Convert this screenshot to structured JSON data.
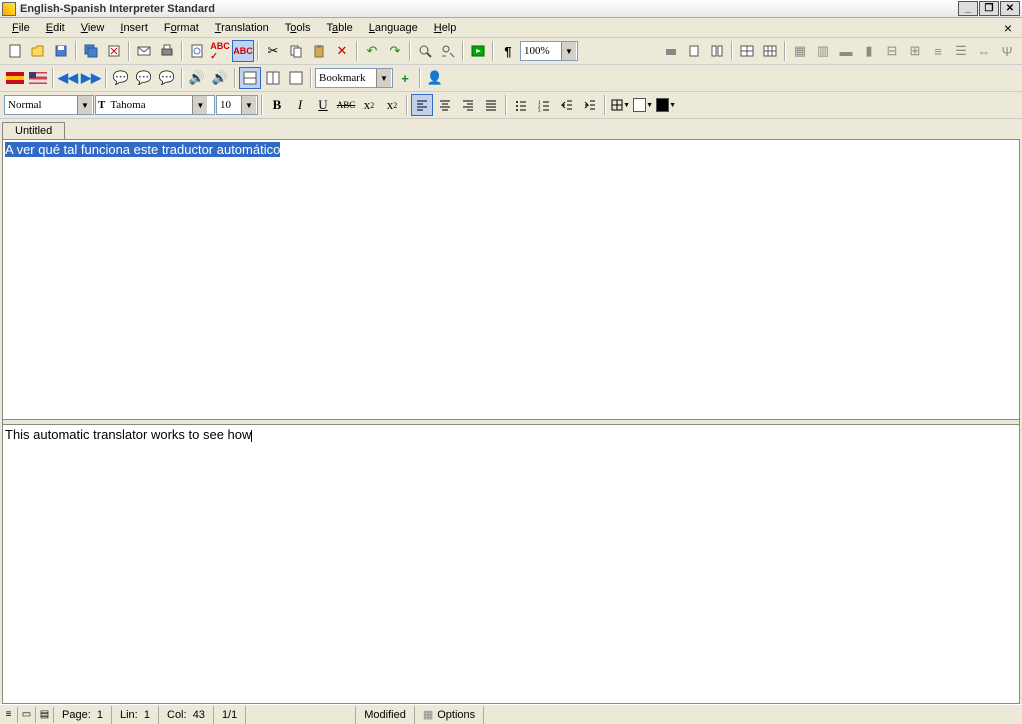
{
  "window": {
    "title": "English-Spanish Interpreter Standard"
  },
  "menu": {
    "file": "File",
    "edit": "Edit",
    "view": "View",
    "insert": "Insert",
    "format": "Format",
    "translation": "Translation",
    "tools": "Tools",
    "table": "Table",
    "language": "Language",
    "help": "Help"
  },
  "toolbar1": {
    "zoom": "100%"
  },
  "toolbar2": {
    "bookmark": "Bookmark"
  },
  "format": {
    "style": "Normal",
    "font": "Tahoma",
    "size": "10",
    "bold": "B",
    "italic": "I",
    "underline": "U",
    "strike": "ABC"
  },
  "tab": {
    "name": "Untitled"
  },
  "source": {
    "text": "A ver qué tal funciona este traductor automático"
  },
  "target": {
    "text": "This automatic translator works to see how"
  },
  "status": {
    "page_label": "Page:",
    "page": "1",
    "lin_label": "Lin:",
    "lin": "1",
    "col_label": "Col:",
    "col": "43",
    "pages": "1/1",
    "modified": "Modified",
    "options": "Options"
  }
}
